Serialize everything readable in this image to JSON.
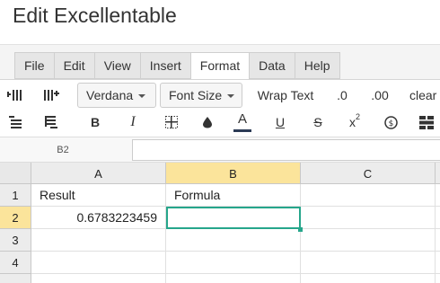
{
  "app": {
    "title": "Edit Excellentable"
  },
  "menu": {
    "items": [
      {
        "label": "File"
      },
      {
        "label": "Edit"
      },
      {
        "label": "View"
      },
      {
        "label": "Insert"
      },
      {
        "label": "Format",
        "active": true
      },
      {
        "label": "Data"
      },
      {
        "label": "Help"
      }
    ]
  },
  "toolbar": {
    "font_family": "Verdana",
    "font_size": "Font Size",
    "wrap_text": "Wrap Text",
    "decimal_decrease": ".0",
    "decimal_increase": ".00",
    "clear": "clear",
    "bold": "B",
    "italic": "I",
    "font_color": "A",
    "underline": "U",
    "strikethrough": "S",
    "superscript_x": "x",
    "superscript_2": "2",
    "accent_color": "#2b3a55",
    "icons": [
      "insert-column-left-icon",
      "insert-column-right-icon",
      "insert-row-above-icon",
      "insert-row-below-icon",
      "borders-icon",
      "fill-color-icon",
      "currency-icon",
      "merge-cells-icon"
    ]
  },
  "formula_bar": {
    "name_box": "B2",
    "value": ""
  },
  "sheet": {
    "columns": [
      "A",
      "B",
      "C"
    ],
    "rows": [
      "1",
      "2",
      "3",
      "4"
    ],
    "selected_cell": "B2",
    "selection_color": "#26a68b",
    "header_highlight": "#fbe49b",
    "cells": {
      "A1": "Result",
      "B1": "Formula",
      "A2": "0.6783223459",
      "B2": ""
    }
  }
}
